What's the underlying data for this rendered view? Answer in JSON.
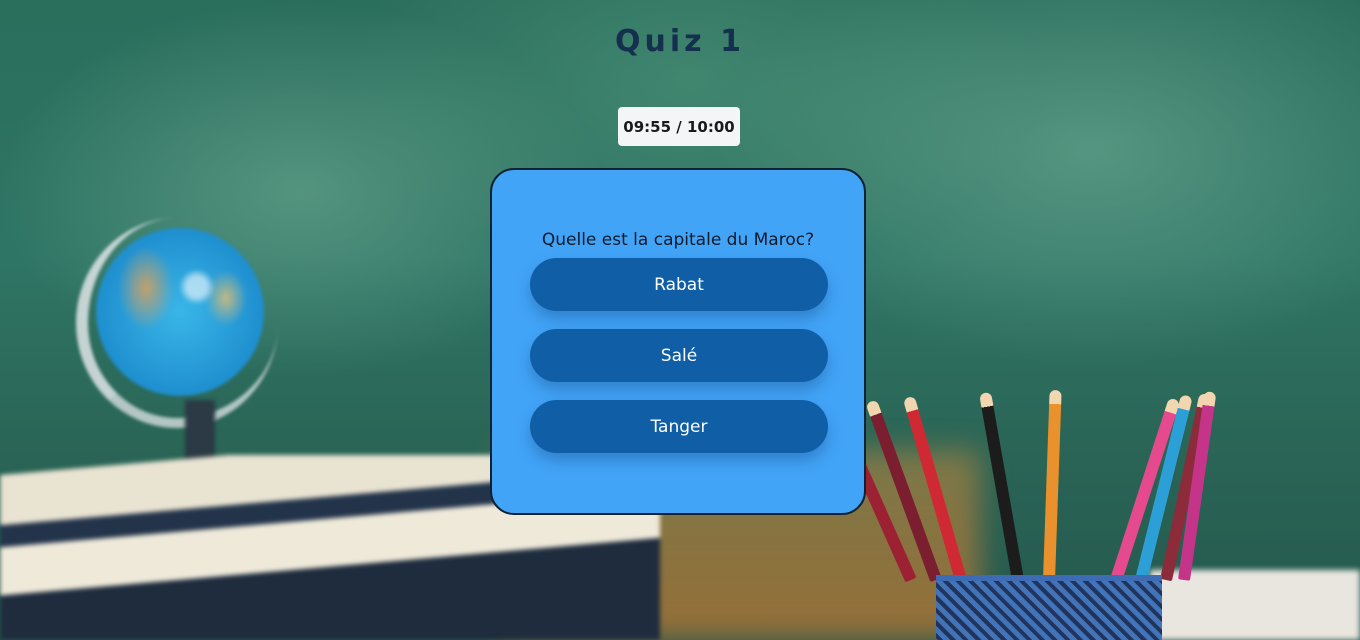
{
  "quiz": {
    "title": "Quiz 1",
    "timer": "09:55 / 10:00",
    "question": "Quelle est la capitale du Maroc?",
    "answers": [
      {
        "label": "Rabat"
      },
      {
        "label": "Salé"
      },
      {
        "label": "Tanger"
      }
    ]
  },
  "colors": {
    "card_background": "#42a4f7",
    "answer_button": "#0f5ea6",
    "title_text": "#15304e"
  },
  "background": {
    "description_icons": [
      "globe-icon",
      "books-icon",
      "pencil-cup-icon"
    ]
  }
}
